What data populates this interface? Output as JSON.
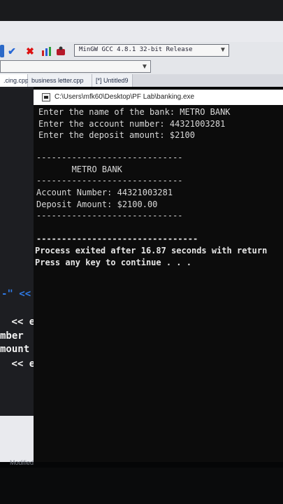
{
  "ide": {
    "compiler": "MinGW GCC 4.8.1 32-bit Release",
    "tabs": [
      ".cing.cpp",
      "business letter.cpp",
      "[*] Untitled9"
    ],
    "status": "Modified",
    "code_lines": [
      "-\" <<",
      " << en",
      "mber ",
      "mount",
      " << en"
    ]
  },
  "console": {
    "title": "C:\\Users\\mfk60\\Desktop\\PF Lab\\banking.exe",
    "lines": [
      "Enter the name of the bank: METRO BANK",
      "Enter the account number: 44321003281",
      "Enter the deposit amount: $2100",
      "-----------------------------",
      "       METRO BANK",
      "-----------------------------",
      "Account Number: 44321003281",
      "Deposit Amount: $2100.00",
      "-----------------------------",
      "--------------------------------",
      "Process exited after 16.87 seconds with return",
      "Press any key to continue . . ."
    ]
  },
  "colors": {
    "console_bg": "#0c0c0c",
    "console_text": "#d9d9d9",
    "editor_bg": "#1d1e22",
    "string_blue": "#2f7ae5"
  },
  "icons": [
    "check-icon",
    "close-icon",
    "chart-icon",
    "debug-icon",
    "chevron-down-icon",
    "console-app-icon"
  ]
}
